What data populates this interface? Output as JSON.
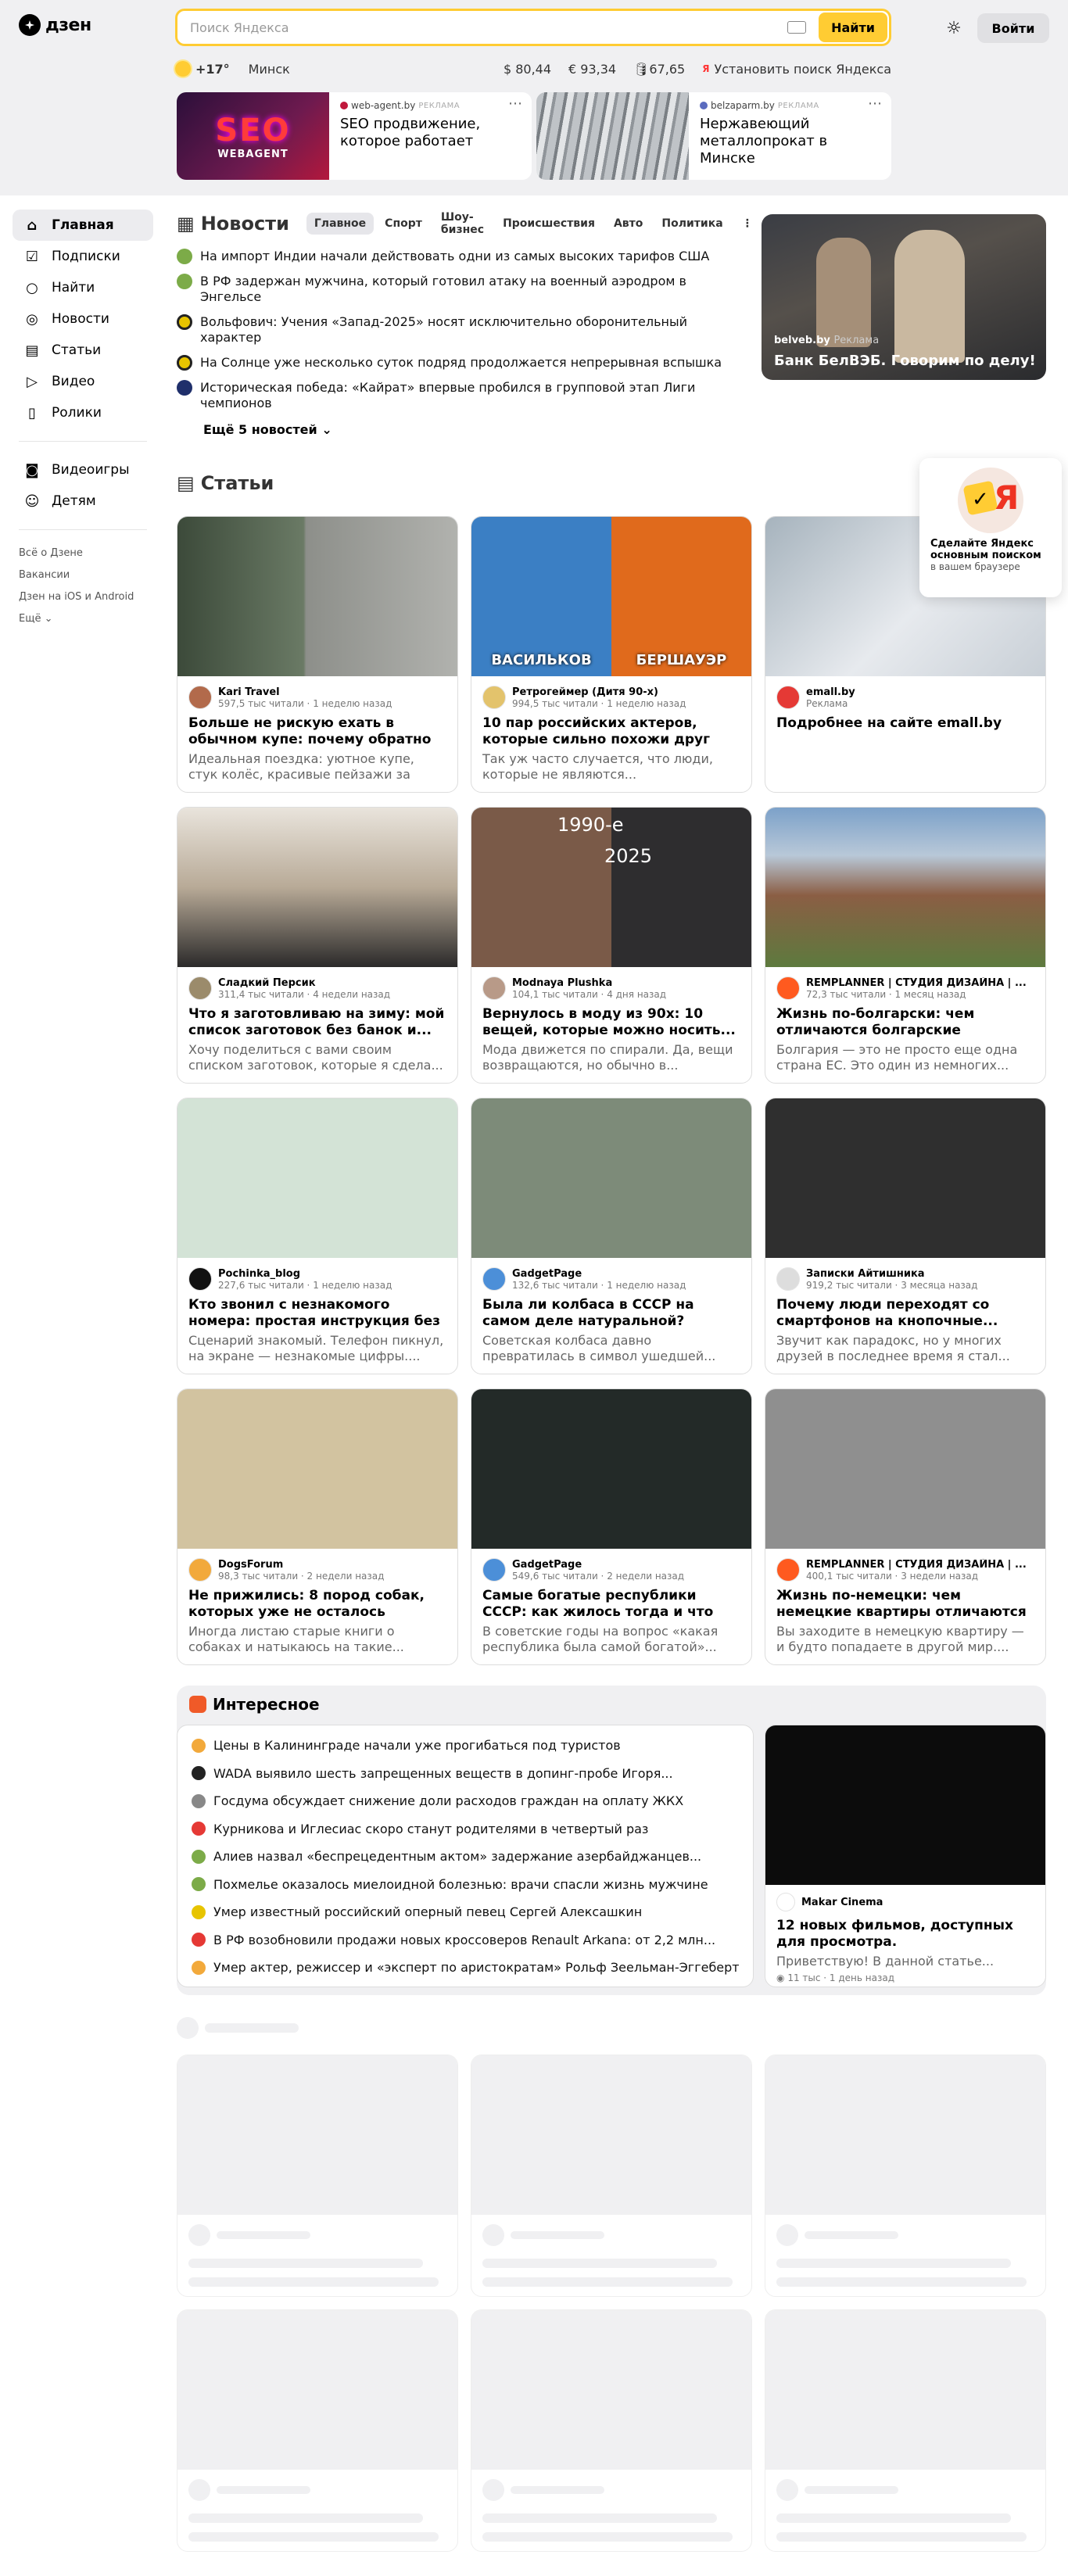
{
  "header": {
    "logo_text": "дзен",
    "search_placeholder": "Поиск Яндекса",
    "find_label": "Найти",
    "login_label": "Войти",
    "theme_icon": "sun-icon"
  },
  "info": {
    "temp": "+17°",
    "city": "Минск",
    "usd": "$ 80,44",
    "eur": "€ 93,34",
    "oil": "🛢67,65",
    "install": "Установить поиск Яндекса"
  },
  "ads": [
    {
      "source": "web-agent.by",
      "tag": "РЕКЛАМА",
      "title": "SEO продвижение, которое работает",
      "img_text": "SEO",
      "img_sub": "WEBAGENT"
    },
    {
      "source": "belzaparm.by",
      "tag": "РЕКЛАМА",
      "title": "Нержавеющий металлопрокат в Минске"
    }
  ],
  "sidebar": {
    "items": [
      {
        "label": "Главная",
        "icon": "home-icon"
      },
      {
        "label": "Подписки",
        "icon": "subscriptions-icon"
      },
      {
        "label": "Найти",
        "icon": "search-icon"
      },
      {
        "label": "Новости",
        "icon": "news-icon"
      },
      {
        "label": "Статьи",
        "icon": "articles-icon"
      },
      {
        "label": "Видео",
        "icon": "video-icon"
      },
      {
        "label": "Ролики",
        "icon": "shorts-icon"
      }
    ],
    "items2": [
      {
        "label": "Видеоигры",
        "icon": "gamepad-icon"
      },
      {
        "label": "Детям",
        "icon": "kids-icon"
      }
    ],
    "links": [
      "Всё о Дзене",
      "Вакансии",
      "Дзен на iOS и Android",
      "Ещё"
    ]
  },
  "news": {
    "title": "Новости",
    "tabs": [
      "Главное",
      "Спорт",
      "Шоу-бизнес",
      "Происшествия",
      "Авто",
      "Политика"
    ],
    "items": [
      "На импорт Индии начали действовать одни из самых высоких тарифов США",
      "В РФ задержан мужчина, который готовил атаку на военный аэродром в Энгельсе",
      "Вольфович: Учения «Запад-2025» носят исключительно оборонительный характер",
      "На Солнце уже несколько суток подряд продолжается непрерывная вспышка",
      "Историческая победа: «Кайрат» впервые пробился в групповой этап Лиги чемпионов"
    ],
    "more": "Ещё 5 новостей",
    "card_source": "belveb.by",
    "card_tag": "Реклама",
    "card_title": "Банк БелВЭБ. Говорим по делу!"
  },
  "articles": {
    "title": "Статьи",
    "cards": [
      {
        "author": "Kari Travel",
        "meta": "597,5 тыс читали · 1 неделю назад",
        "title": "Больше не рискую ехать в обычном купе: почему обратно м...",
        "desc": "Идеальная поездка: уютное купе, стук колёс, красивые пейзажи за окном...."
      },
      {
        "author": "Ретрогеймер (Дитя 90-х)",
        "meta": "994,5 тыс читали · 1 неделю назад",
        "title": "10 пар российских актеров, которые сильно похожи друг на...",
        "desc": "Так уж часто случается, что люди, которые не являются...",
        "img_l": "ВАСИЛЬКОВ",
        "img_r": "БЕРШАУЭР"
      },
      {
        "author": "emall.by",
        "meta": "Реклама",
        "title": "Подробнее на сайте emall.by",
        "desc": ""
      },
      {
        "author": "Сладкий Персик",
        "meta": "311,4 тыс читали · 4 недели назад",
        "title": "Что я заготовливаю на зиму: мой список заготовок без банок и...",
        "desc": "Хочу поделиться с вами своим списком заготовок, которые я сдела..."
      },
      {
        "author": "Modnaya Plushka",
        "meta": "104,1 тыс читали · 4 дня назад",
        "title": "Вернулось в моду из 90х: 10 вещей, которые можно носить...",
        "desc": "Мода движется по спирали. Да, вещи возвращаются, но обычно в...",
        "img_l": "1990-е",
        "img_r": "2025"
      },
      {
        "author": "REMPLANNER | СТУДИЯ ДИЗАЙНА | ...",
        "meta": "72,3 тыс читали · 1 месяц назад",
        "title": "Жизнь по-болгарски: чем отличаются болгарские квартиры",
        "desc": "Болгария — это не просто еще одна страна ЕС. Это один из немногих..."
      },
      {
        "author": "Pochinka_blog",
        "meta": "227,6 тыс читали · 1 неделю назад",
        "title": "Кто звонил с незнакомого номера: простая инструкция без риска",
        "desc": "Сценарий знакомый. Телефон пикнул, на экране — незнакомые цифры...."
      },
      {
        "author": "GadgetPage",
        "meta": "132,6 тыс читали · 1 неделю назад",
        "title": "Была ли колбаса в СССР на самом деле натуральной? Разбираемся ...",
        "desc": "Советская колбаса давно превратилась в символ ушедшей..."
      },
      {
        "author": "Записки Айтишника",
        "meta": "919,2 тыс читали · 3 месяца назад",
        "title": "Почему люди переходят со смартфонов на кнопочные...",
        "desc": "Звучит как парадокс, но у многих друзей в последнее время я стал..."
      },
      {
        "author": "DogsForum",
        "meta": "98,3 тыс читали · 2 недели назад",
        "title": "Не прижились: 8 пород собак, которых уже не осталось",
        "desc": "Иногда листаю старые книги о собаках и натыкаюсь на такие..."
      },
      {
        "author": "GadgetPage",
        "meta": "549,6 тыс читали · 2 недели назад",
        "title": "Самые богатые республики СССР: как жилось тогда и что сейчас",
        "desc": "В советские годы на вопрос «какая республика была самой богатой»..."
      },
      {
        "author": "REMPLANNER | СТУДИЯ ДИЗАЙНА | ...",
        "meta": "400,1 тыс читали · 3 недели назад",
        "title": "Жизнь по-немецки: чем немецкие квартиры отличаются от...",
        "desc": "Вы заходите в немецкую квартиру — и будто попадаете в другой мир...."
      }
    ]
  },
  "promo": {
    "title": "Сделайте Яндекс основным поиском",
    "sub": "в вашем браузере",
    "logo_letter": "Я"
  },
  "interesting": {
    "title": "Интересное",
    "items": [
      "Цены в Калининграде начали уже прогибаться под туристов",
      "WADA выявило шесть запрещенных веществ в допинг-пробе Игоря...",
      "Госдума обсуждает снижение доли расходов граждан на оплату ЖКХ",
      "Курникова и Иглесиас скоро станут родителями в четвертый раз",
      "Алиев назвал «беспрецедентным актом» задержание азербайджанцев...",
      "Похмелье оказалось миелоидной болезнью: врачи спасли жизнь мужчине",
      "Умер известный российский оперный певец Сергей Алексашкин",
      "В РФ возобновили продажи новых кроссоверов Renault Arkana: от 2,2 млн...",
      "Умер актер, режиссер и «эксперт по аристократам» Рольф Зеельман-Эггеберт"
    ],
    "card": {
      "author": "Makar Cinema",
      "title": "12 новых фильмов, доступных для просмотра.",
      "desc": "Приветствую! В данной статье...",
      "meta": "11 тыс · 1 день назад"
    }
  },
  "colors": {
    "accent": "#ffcc33",
    "bg": "#f0f0f2"
  }
}
